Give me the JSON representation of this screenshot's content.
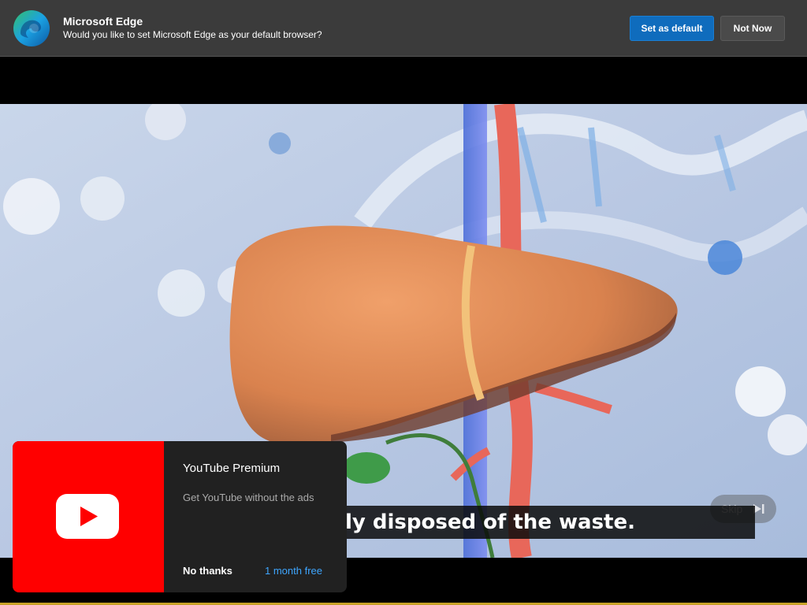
{
  "edge_prompt": {
    "title": "Microsoft Edge",
    "message": "Would you like to set Microsoft Edge as your default browser?",
    "primary_button": "Set as default",
    "secondary_button": "Not Now",
    "icon": "edge-logo-icon"
  },
  "video": {
    "caption": "ly disposed of the waste.",
    "skip_label": "Skip",
    "skip_icon": "skip-next-icon"
  },
  "premium_promo": {
    "title": "YouTube Premium",
    "description": "Get YouTube without the ads",
    "decline_label": "No thanks",
    "accept_label": "1 month free",
    "icon": "youtube-logo-icon",
    "colors": {
      "art": "#ff0000",
      "accent": "#3ea6ff"
    }
  }
}
